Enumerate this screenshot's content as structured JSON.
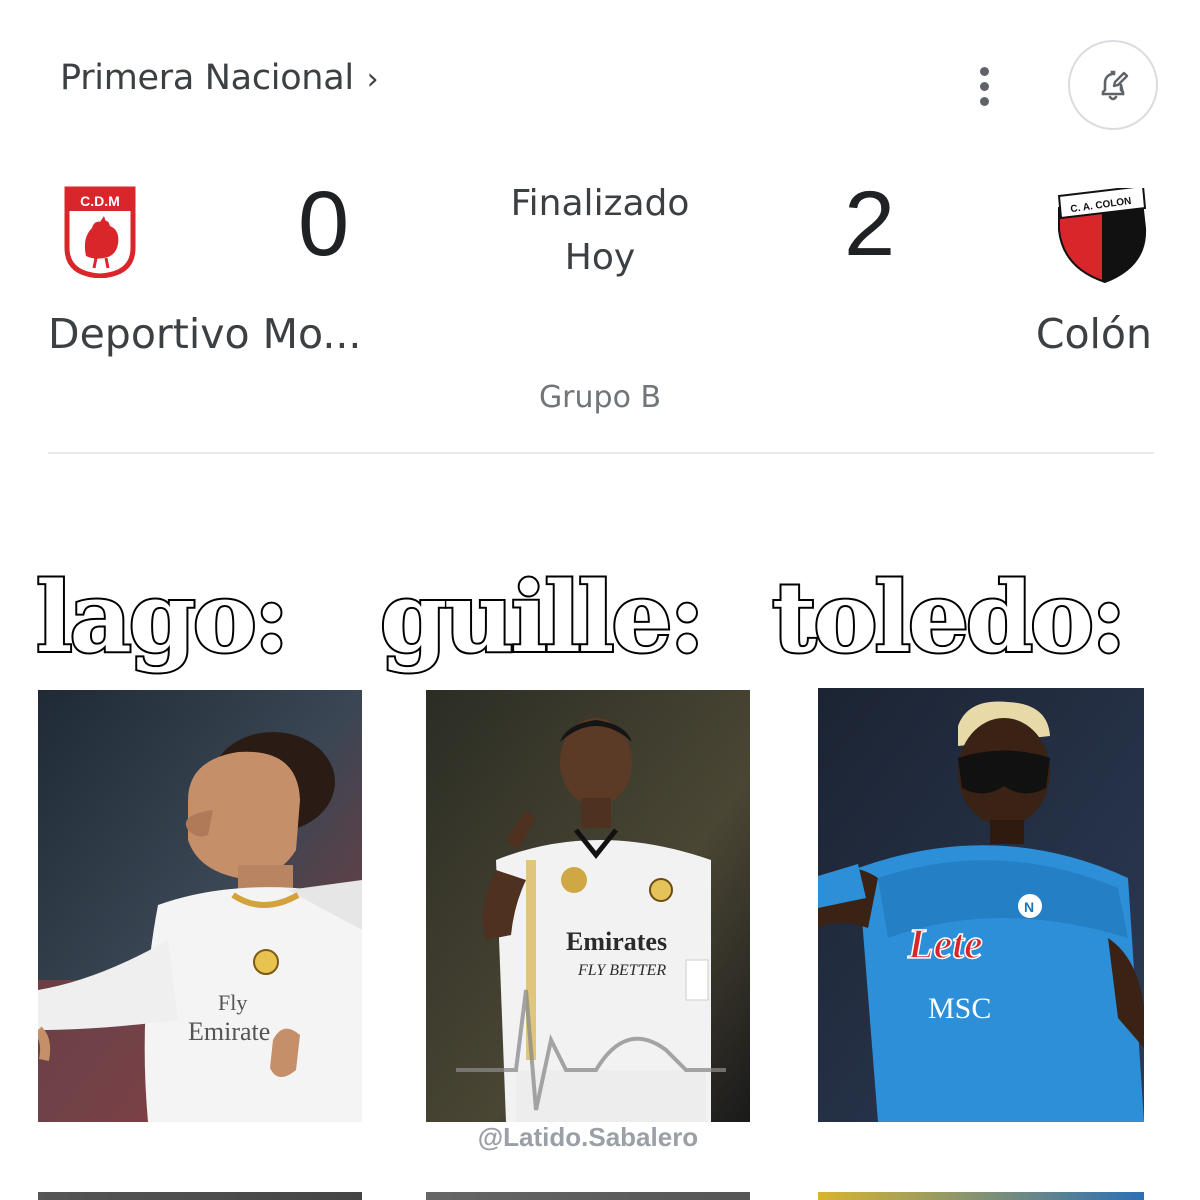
{
  "card": {
    "league": "Primera Nacional",
    "league_chevron": "›",
    "more_icon": "more-vert-icon",
    "alert_icon": "bell-edit-icon",
    "status_line1": "Finalizado",
    "status_line2": "Hoy",
    "group": "Grupo B",
    "home": {
      "name": "Deportivo Mo...",
      "score": "0",
      "crest_text": "C.D.M",
      "crest_color": "#d9262b"
    },
    "away": {
      "name": "Colón",
      "score": "2",
      "crest_text": "C. A. COLON",
      "crest_colors": [
        "#d9262b",
        "#111111"
      ]
    }
  },
  "meme": {
    "captions": [
      "lago:",
      "guille:",
      "toledo:"
    ],
    "watermark": "@Latido.Sabalero",
    "photos": [
      {
        "subject": "player in white Real Madrid kit",
        "kit_text": "Fly Emirates"
      },
      {
        "subject": "player in white Real Madrid kit pointing",
        "kit_text": "Emirates FLY BETTER"
      },
      {
        "subject": "player in blue Napoli kit with mask",
        "kit_text": "Lete MSC"
      }
    ]
  }
}
